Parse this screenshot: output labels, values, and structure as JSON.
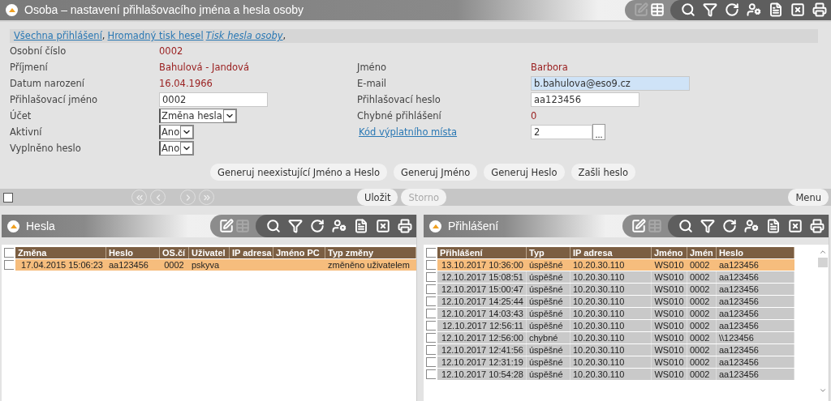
{
  "window": {
    "title": "Osoba – nastavení přihlašovacího jména a hesla osoby",
    "toolbar": {
      "edit_group": [
        {
          "kind": "edit",
          "disabled": true
        },
        {
          "kind": "table",
          "disabled": false
        }
      ],
      "action_group": [
        {
          "kind": "search",
          "disabled": false
        },
        {
          "kind": "filter",
          "disabled": false
        },
        {
          "kind": "refresh",
          "disabled": false
        },
        {
          "kind": "user-settings",
          "disabled": false
        },
        {
          "kind": "document",
          "disabled": false
        },
        {
          "kind": "excel",
          "disabled": false
        },
        {
          "kind": "print",
          "disabled": false
        }
      ]
    }
  },
  "links": [
    {
      "text": "Všechna přihlášení",
      "italic": false,
      "separator": ","
    },
    {
      "text": "Hromadný tisk hesel",
      "italic": false
    },
    {
      "text": "Tisk hesla osoby",
      "italic": true,
      "separator": ","
    }
  ],
  "form": {
    "left": [
      {
        "label": "Osobní číslo",
        "kind": "value",
        "value": "0002"
      },
      {
        "label": "Příjmení",
        "kind": "value",
        "value": "Bahulová - Jandová"
      },
      {
        "label": "Datum narození",
        "kind": "value",
        "value": "16.04.1966"
      },
      {
        "label": "Přihlašovací jméno",
        "kind": "input",
        "value": "0002"
      },
      {
        "label": "Účet",
        "kind": "select",
        "value": "Změna hesla"
      },
      {
        "label": "Aktivní",
        "kind": "select",
        "value": "Ano"
      },
      {
        "label": "Vyplněno heslo",
        "kind": "select",
        "value": "Ano"
      }
    ],
    "right": [
      {
        "label": "Jméno",
        "kind": "value",
        "value": "Barbora"
      },
      {
        "label": "E-mail",
        "kind": "email",
        "value": "b.bahulova@eso9.cz"
      },
      {
        "label": "Přihlašovací heslo",
        "kind": "input",
        "value": "aa123456"
      },
      {
        "label": "Chybné přihlášení",
        "kind": "value",
        "value": "0"
      },
      {
        "label": "Kód výplatního místa",
        "kind": "lookup",
        "value": "2",
        "button": "..."
      }
    ]
  },
  "actions": [
    "Generuj neexistující Jméno a Heslo",
    "Generuj Jméno",
    "Generuj Heslo",
    "Zašli heslo"
  ],
  "navbar": {
    "select_all": false,
    "nav": [
      {
        "kind": "first"
      },
      {
        "kind": "prev"
      },
      {
        "kind": "next"
      },
      {
        "kind": "last"
      }
    ],
    "buttons": [
      {
        "label": "Uložit",
        "disabled": false
      },
      {
        "label": "Storno",
        "disabled": true
      }
    ],
    "menu": "Menu"
  },
  "panels": [
    {
      "title": "Hesla",
      "toolbar": {
        "edit_group": [
          {
            "kind": "edit",
            "disabled": false
          },
          {
            "kind": "table",
            "disabled": true
          }
        ],
        "action_group": [
          {
            "kind": "search",
            "disabled": false
          },
          {
            "kind": "filter",
            "disabled": false
          },
          {
            "kind": "refresh",
            "disabled": false
          },
          {
            "kind": "user-settings",
            "disabled": false
          },
          {
            "kind": "document",
            "disabled": false
          },
          {
            "kind": "excel",
            "disabled": false
          },
          {
            "kind": "print",
            "disabled": false
          }
        ]
      },
      "scrollbar": false,
      "select_all": false,
      "columns": [
        "Změna",
        "Heslo",
        "OS.čí",
        "Uživatel",
        "IP adresa",
        "Jméno PC",
        "Typ změny"
      ],
      "rows": [
        {
          "selected": true,
          "checked": false,
          "cells": [
            "17.04.2015 15:06:23",
            "aa123456",
            "0002",
            "pskyva",
            "",
            "",
            "změněno uživatelem"
          ]
        }
      ]
    },
    {
      "title": "Přihlášení",
      "toolbar": {
        "edit_group": [
          {
            "kind": "edit",
            "disabled": false
          },
          {
            "kind": "table",
            "disabled": true
          }
        ],
        "action_group": [
          {
            "kind": "search",
            "disabled": false
          },
          {
            "kind": "filter",
            "disabled": false
          },
          {
            "kind": "refresh",
            "disabled": false
          },
          {
            "kind": "user-settings",
            "disabled": false
          },
          {
            "kind": "document",
            "disabled": false
          },
          {
            "kind": "excel",
            "disabled": false
          },
          {
            "kind": "print",
            "disabled": false
          }
        ]
      },
      "scrollbar": true,
      "select_all": false,
      "columns": [
        "Přihlášení",
        "Typ",
        "IP adresa",
        "Jméno",
        "Jmén",
        "Heslo"
      ],
      "rows": [
        {
          "selected": true,
          "checked": false,
          "cells": [
            "13.10.2017 10:36:00",
            "úspěšné",
            "10.20.30.110",
            "WS010",
            "0002",
            "aa123456"
          ]
        },
        {
          "selected": false,
          "checked": false,
          "cells": [
            "12.10.2017 15:08:51",
            "úspěšné",
            "10.20.30.110",
            "WS010",
            "0002",
            "aa123456"
          ]
        },
        {
          "selected": false,
          "checked": false,
          "cells": [
            "12.10.2017 15:00:47",
            "úspěšné",
            "10.20.30.110",
            "WS010",
            "0002",
            "aa123456"
          ]
        },
        {
          "selected": false,
          "checked": false,
          "cells": [
            "12.10.2017 14:25:44",
            "úspěšné",
            "10.20.30.110",
            "WS010",
            "0002",
            "aa123456"
          ]
        },
        {
          "selected": false,
          "checked": false,
          "cells": [
            "12.10.2017 14:03:43",
            "úspěšné",
            "10.20.30.110",
            "WS010",
            "0002",
            "aa123456"
          ]
        },
        {
          "selected": false,
          "checked": false,
          "cells": [
            "12.10.2017 12:56:11",
            "úspěšné",
            "10.20.30.110",
            "WS010",
            "0002",
            "aa123456"
          ]
        },
        {
          "selected": false,
          "checked": false,
          "cells": [
            "12.10.2017 12:56:00",
            "chybné",
            "10.20.30.110",
            "WS010",
            "0002",
            "\\\\123456"
          ]
        },
        {
          "selected": false,
          "checked": false,
          "cells": [
            "12.10.2017 12:41:56",
            "úspěšné",
            "10.20.30.110",
            "WS010",
            "0002",
            "aa123456"
          ]
        },
        {
          "selected": false,
          "checked": false,
          "cells": [
            "12.10.2017 12:31:19",
            "úspěšné",
            "10.20.30.110",
            "WS010",
            "0002",
            "aa123456"
          ]
        },
        {
          "selected": false,
          "checked": false,
          "cells": [
            "12.10.2017 10:54:28",
            "úspěšné",
            "10.20.30.110",
            "WS010",
            "0002",
            "aa123456"
          ]
        }
      ]
    }
  ]
}
